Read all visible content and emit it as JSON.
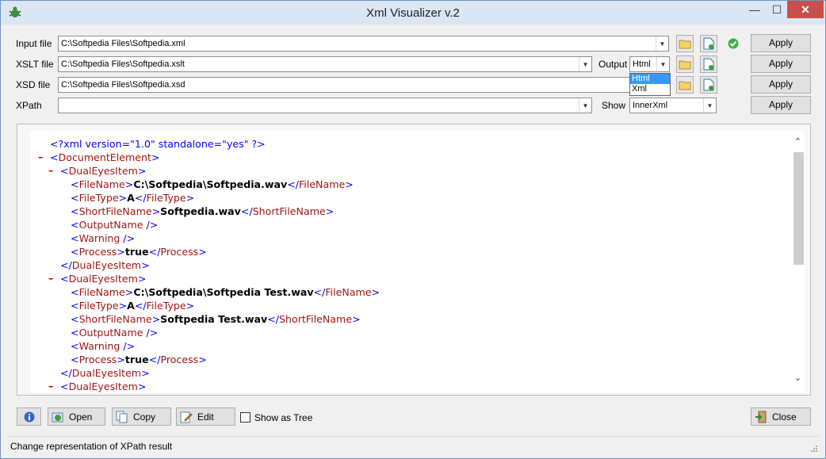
{
  "window": {
    "title": "Xml Visualizer v.2",
    "minimize": "—",
    "maximize": "☐",
    "close": "✕"
  },
  "form": {
    "input_label": "Input file",
    "input_value": "C:\\Softpedia Files\\Softpedia.xml",
    "xslt_label": "XSLT file",
    "xslt_value": "C:\\Softpedia Files\\Softpedia.xslt",
    "xsd_label": "XSD file",
    "xsd_value": "C:\\Softpedia Files\\Softpedia.xsd",
    "xpath_label": "XPath",
    "xpath_value": "",
    "output_label": "Output",
    "output_value": "Html",
    "output_options": [
      "Html",
      "Xml"
    ],
    "show_label": "Show",
    "show_value": "InnerXml",
    "apply_label": "Apply"
  },
  "xml": {
    "lines": [
      {
        "minus": "",
        "parts": [
          [
            "p",
            "<?xml version=\"1.0\" standalone=\"yes\" ?>"
          ]
        ]
      },
      {
        "minus": "–",
        "parts": [
          [
            "p",
            "<"
          ],
          [
            "t",
            "DocumentElement"
          ],
          [
            "p",
            ">"
          ]
        ]
      },
      {
        "minus": "–",
        "parts": [
          [
            "p",
            "<"
          ],
          [
            "t",
            "DualEyesItem"
          ],
          [
            "p",
            ">"
          ]
        ]
      },
      {
        "minus": "",
        "parts": [
          [
            "p",
            "<"
          ],
          [
            "t",
            "FileName"
          ],
          [
            "p",
            ">"
          ],
          [
            "x",
            "C:\\Softpedia\\Softpedia.wav"
          ],
          [
            "p",
            "</"
          ],
          [
            "t",
            "FileName"
          ],
          [
            "p",
            ">"
          ]
        ]
      },
      {
        "minus": "",
        "parts": [
          [
            "p",
            "<"
          ],
          [
            "t",
            "FileType"
          ],
          [
            "p",
            ">"
          ],
          [
            "x",
            "A"
          ],
          [
            "p",
            "</"
          ],
          [
            "t",
            "FileType"
          ],
          [
            "p",
            ">"
          ]
        ]
      },
      {
        "minus": "",
        "parts": [
          [
            "p",
            "<"
          ],
          [
            "t",
            "ShortFileName"
          ],
          [
            "p",
            ">"
          ],
          [
            "x",
            "Softpedia.wav"
          ],
          [
            "p",
            "</"
          ],
          [
            "t",
            "ShortFileName"
          ],
          [
            "p",
            ">"
          ]
        ]
      },
      {
        "minus": "",
        "parts": [
          [
            "p",
            "<"
          ],
          [
            "t",
            "OutputName"
          ],
          [
            "p",
            " />"
          ]
        ]
      },
      {
        "minus": "",
        "parts": [
          [
            "p",
            "<"
          ],
          [
            "t",
            "Warning"
          ],
          [
            "p",
            " />"
          ]
        ]
      },
      {
        "minus": "",
        "parts": [
          [
            "p",
            "<"
          ],
          [
            "t",
            "Process"
          ],
          [
            "p",
            ">"
          ],
          [
            "x",
            "true"
          ],
          [
            "p",
            "</"
          ],
          [
            "t",
            "Process"
          ],
          [
            "p",
            ">"
          ]
        ]
      },
      {
        "minus": "",
        "parts": [
          [
            "p",
            "</"
          ],
          [
            "t",
            "DualEyesItem"
          ],
          [
            "p",
            ">"
          ]
        ]
      },
      {
        "minus": "–",
        "parts": [
          [
            "p",
            "<"
          ],
          [
            "t",
            "DualEyesItem"
          ],
          [
            "p",
            ">"
          ]
        ]
      },
      {
        "minus": "",
        "parts": [
          [
            "p",
            "<"
          ],
          [
            "t",
            "FileName"
          ],
          [
            "p",
            ">"
          ],
          [
            "x",
            "C:\\Softpedia\\Softpedia Test.wav"
          ],
          [
            "p",
            "</"
          ],
          [
            "t",
            "FileName"
          ],
          [
            "p",
            ">"
          ]
        ]
      },
      {
        "minus": "",
        "parts": [
          [
            "p",
            "<"
          ],
          [
            "t",
            "FileType"
          ],
          [
            "p",
            ">"
          ],
          [
            "x",
            "A"
          ],
          [
            "p",
            "</"
          ],
          [
            "t",
            "FileType"
          ],
          [
            "p",
            ">"
          ]
        ]
      },
      {
        "minus": "",
        "parts": [
          [
            "p",
            "<"
          ],
          [
            "t",
            "ShortFileName"
          ],
          [
            "p",
            ">"
          ],
          [
            "x",
            "Softpedia Test.wav"
          ],
          [
            "p",
            "</"
          ],
          [
            "t",
            "ShortFileName"
          ],
          [
            "p",
            ">"
          ]
        ]
      },
      {
        "minus": "",
        "parts": [
          [
            "p",
            "<"
          ],
          [
            "t",
            "OutputName"
          ],
          [
            "p",
            " />"
          ]
        ]
      },
      {
        "minus": "",
        "parts": [
          [
            "p",
            "<"
          ],
          [
            "t",
            "Warning"
          ],
          [
            "p",
            " />"
          ]
        ]
      },
      {
        "minus": "",
        "parts": [
          [
            "p",
            "<"
          ],
          [
            "t",
            "Process"
          ],
          [
            "p",
            ">"
          ],
          [
            "x",
            "true"
          ],
          [
            "p",
            "</"
          ],
          [
            "t",
            "Process"
          ],
          [
            "p",
            ">"
          ]
        ]
      },
      {
        "minus": "",
        "parts": [
          [
            "p",
            "</"
          ],
          [
            "t",
            "DualEyesItem"
          ],
          [
            "p",
            ">"
          ]
        ]
      },
      {
        "minus": "–",
        "parts": [
          [
            "p",
            "<"
          ],
          [
            "t",
            "DualEyesItem"
          ],
          [
            "p",
            ">"
          ]
        ]
      }
    ]
  },
  "bottom": {
    "open_label": "Open",
    "copy_label": "Copy",
    "edit_label": "Edit",
    "show_as_tree_label": "Show as Tree",
    "close_label": "Close"
  },
  "status_text": "Change representation of XPath result",
  "colors": {
    "tag": "#a31515",
    "punct": "#0000ff",
    "accent": "#3399ff"
  }
}
